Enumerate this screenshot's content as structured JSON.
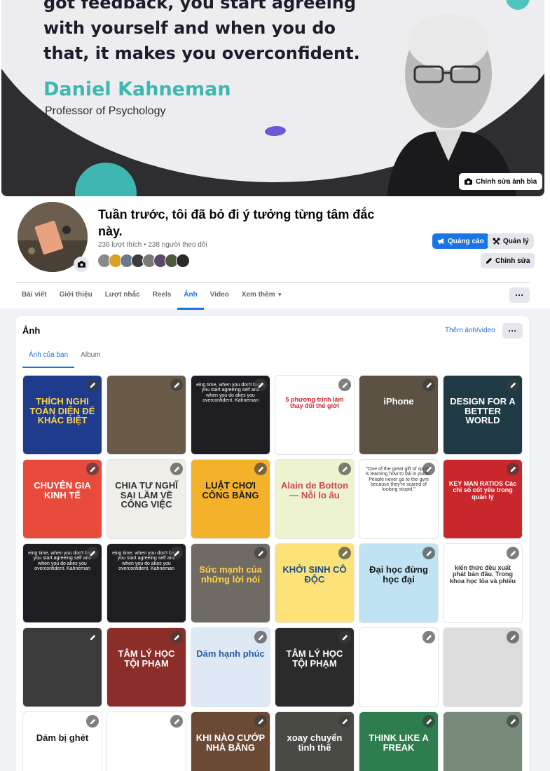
{
  "cover": {
    "quote": "got feedback, you start agreeing with yourself and when you do that, it makes you overconfident.",
    "author": "Daniel Kahneman",
    "author_title": "Professor of Psychology",
    "edit_label": "Chỉnh sửa ảnh bìa"
  },
  "page": {
    "name": "Tuần trước, tôi đã bỏ đi ý tưởng từng tâm đắc này.",
    "stats": "236 lượt thích • 238 người theo dõi"
  },
  "actions": {
    "ads_label": "Quảng cáo",
    "manage_label": "Quản lý",
    "edit_label": "Chỉnh sửa"
  },
  "tabs": [
    {
      "label": "Bài viết"
    },
    {
      "label": "Giới thiệu"
    },
    {
      "label": "Lượt nhắc"
    },
    {
      "label": "Reels"
    },
    {
      "label": "Ảnh"
    },
    {
      "label": "Video"
    },
    {
      "label": "Xem thêm"
    }
  ],
  "tabs_more_icon": "···",
  "photos": {
    "title": "Ảnh",
    "add_link": "Thêm ảnh/video",
    "more_icon": "···",
    "sub_tabs": [
      {
        "label": "Ảnh của bạn"
      },
      {
        "label": "Album"
      }
    ],
    "tiles": [
      {
        "bg": "#1f3b8c",
        "fg": "#ffd24a",
        "text": "THÍCH NGHI TOÀN DIỆN ĐỂ KHÁC BIỆT"
      },
      {
        "bg": "#6a5a48",
        "fg": "#f2b28c",
        "text": ""
      },
      {
        "bg": "#1e1e22",
        "fg": "#ffffff",
        "text": "eing time, when you don't back, you start agreeing self and when you do akes you overconfident. Kahneman"
      },
      {
        "bg": "#ffffff",
        "fg": "#d8262c",
        "text": "5 phương trình làm thay đổi thế giới"
      },
      {
        "bg": "#5b5244",
        "fg": "#ffffff",
        "text": "iPhone"
      },
      {
        "bg": "#203a45",
        "fg": "#ffffff",
        "text": "DESIGN FOR A BETTER WORLD"
      },
      {
        "bg": "#e84b3c",
        "fg": "#ffffff",
        "text": "CHUYÊN GIA KINH TẾ"
      },
      {
        "bg": "#efeee8",
        "fg": "#333333",
        "text": "CHIA TƯ NGHĨ SAI LẦM VỀ CÔNG VIỆC"
      },
      {
        "bg": "#f4b22a",
        "fg": "#1a1a1a",
        "text": "LUẬT CHƠI CÔNG BẰNG"
      },
      {
        "bg": "#eef3cf",
        "fg": "#c9485b",
        "text": "Alain de Botton — Nỗi lo âu"
      },
      {
        "bg": "#ffffff",
        "fg": "#333333",
        "text": "\"One of the great gift of sports is learning how to fail in public. People never go to the gym because they're scared of looking stupid.\""
      },
      {
        "bg": "#c8272c",
        "fg": "#ffffff",
        "text": "KEY MAN RATIOS Các chỉ số cốt yếu trong quản lý"
      },
      {
        "bg": "#1e1e22",
        "fg": "#ffffff",
        "text": "eing time, when you don't back, you start agreeing self and when you do akes you overconfident. Kahneman"
      },
      {
        "bg": "#1e1e22",
        "fg": "#ffffff",
        "text": "eing time, when you don't back, you start agreeing self and when you do akes you overconfident. Kahneman"
      },
      {
        "bg": "#6f6a63",
        "fg": "#ffd24a",
        "text": "Sức mạnh của những lời nói"
      },
      {
        "bg": "#fde27a",
        "fg": "#1c4f8f",
        "text": "KHỞI SINH CÔ ĐỘC"
      },
      {
        "bg": "#bfe3f2",
        "fg": "#1a1a1a",
        "text": "Đại học đừng học đại"
      },
      {
        "bg": "#ffffff",
        "fg": "#333333",
        "text": "kiến thức đều xuất phát bản đầu. Trong khoa học lòa và phiếu"
      },
      {
        "bg": "#3b3b3b",
        "fg": "#ffffff",
        "text": ""
      },
      {
        "bg": "#8b2e2a",
        "fg": "#ffffff",
        "text": "TÂM LÝ HỌC TỘI PHẠM"
      },
      {
        "bg": "#dfe9f5",
        "fg": "#2b5c9e",
        "text": "Dám hạnh phúc"
      },
      {
        "bg": "#2b2b2b",
        "fg": "#ffffff",
        "text": "TÂM LÝ HỌC TỘI PHẠM"
      },
      {
        "bg": "#ffffff",
        "fg": "#a32020",
        "text": ""
      },
      {
        "bg": "#dcdcdc",
        "fg": "#333333",
        "text": ""
      },
      {
        "bg": "#ffffff",
        "fg": "#1a1a1a",
        "text": "Dám bị ghét"
      },
      {
        "bg": "#ffffff",
        "fg": "#333333",
        "text": ""
      },
      {
        "bg": "#6a4a35",
        "fg": "#ffffff",
        "text": "KHI NÀO CƯỚP NHÀ BĂNG"
      },
      {
        "bg": "#4a4a44",
        "fg": "#ffffff",
        "text": "xoay chuyển tình thế"
      },
      {
        "bg": "#2e7d4f",
        "fg": "#ffffff",
        "text": "THINK LIKE A FREAK"
      },
      {
        "bg": "#7a8a7a",
        "fg": "#ffffff",
        "text": ""
      }
    ]
  }
}
